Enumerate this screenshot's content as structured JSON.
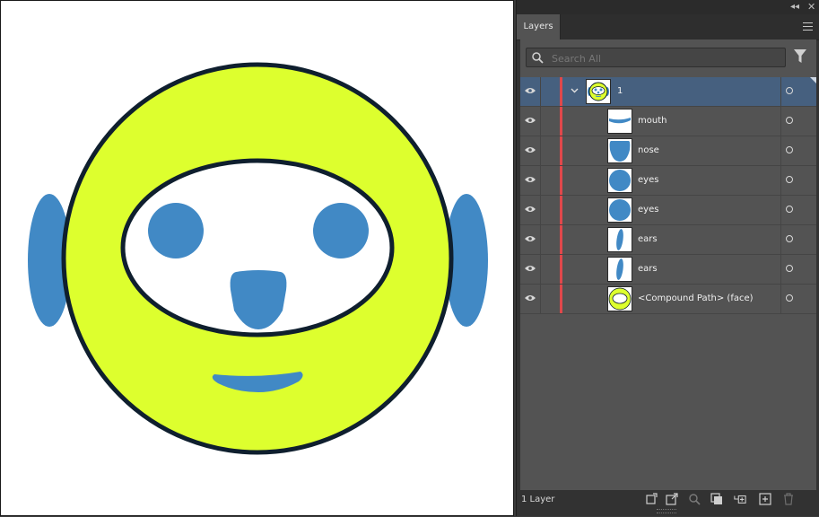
{
  "panel": {
    "tab_label": "Layers",
    "search_placeholder": "Search All",
    "footer_count": "1 Layer"
  },
  "layers": [
    {
      "name": "1",
      "selected": true,
      "type": "layer",
      "thumb": "face-thumb"
    },
    {
      "name": "mouth",
      "type": "sublayer",
      "thumb": "mouth-thumb"
    },
    {
      "name": "nose",
      "type": "sublayer",
      "thumb": "nose-thumb"
    },
    {
      "name": "eyes",
      "type": "sublayer",
      "thumb": "eye-thumb"
    },
    {
      "name": "eyes",
      "type": "sublayer",
      "thumb": "eye-thumb"
    },
    {
      "name": "ears",
      "type": "sublayer",
      "thumb": "ear-thumb"
    },
    {
      "name": "ears",
      "type": "sublayer",
      "thumb": "ear-thumb"
    },
    {
      "name": "<Compound Path> (face)",
      "type": "sublayer",
      "thumb": "face-ring-thumb"
    }
  ],
  "colors": {
    "face": "#ddff2e",
    "outline": "#0f1f2e",
    "features": "#4189c5",
    "layer_color": "#e0484b",
    "selection": "#46607f"
  },
  "icons": [
    "collapse-panel-icon",
    "close-panel-icon",
    "panel-menu-icon",
    "search-icon",
    "filter-icon",
    "visibility-eye-icon",
    "disclosure-chevron-icon",
    "target-circle-icon",
    "collect-for-export-icon",
    "export-icon",
    "locate-object-icon",
    "make-clipping-mask-icon",
    "create-sublayer-icon",
    "new-layer-icon",
    "delete-icon"
  ]
}
